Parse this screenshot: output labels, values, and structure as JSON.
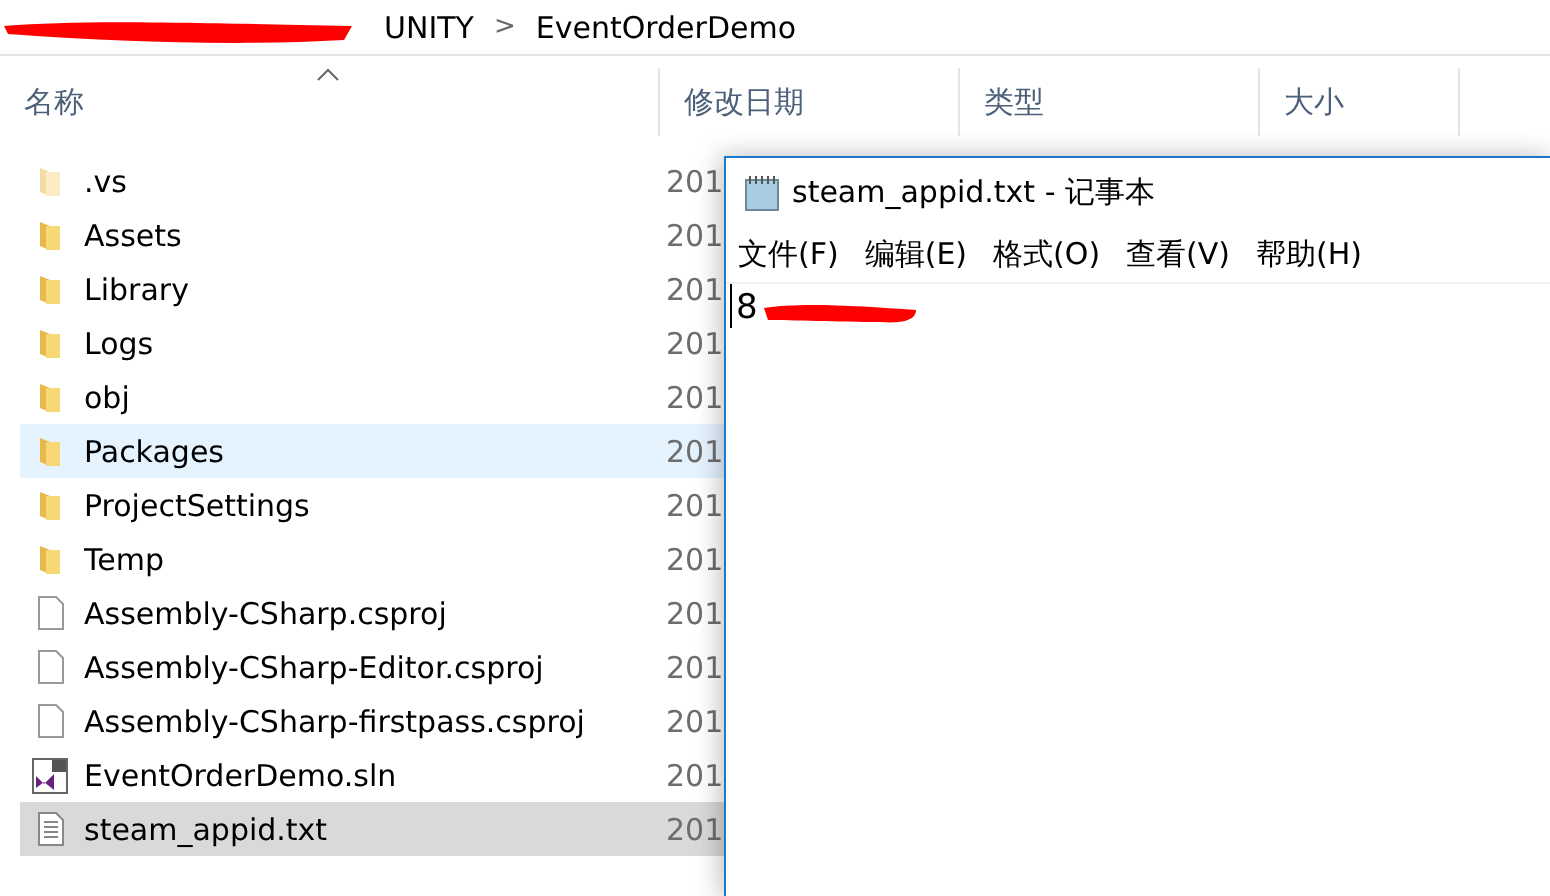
{
  "breadcrumb": {
    "segments": [
      "UNITY",
      "EventOrderDemo"
    ],
    "separator": ">"
  },
  "columns": [
    {
      "label": "名称",
      "sorted": true
    },
    {
      "label": "修改日期",
      "sorted": false
    },
    {
      "label": "类型",
      "sorted": false
    },
    {
      "label": "大小",
      "sorted": false
    }
  ],
  "files": [
    {
      "name": ".vs",
      "kind": "folder",
      "hidden": true,
      "date": "201",
      "hovered": false,
      "selected": false
    },
    {
      "name": "Assets",
      "kind": "folder",
      "hidden": false,
      "date": "201",
      "hovered": false,
      "selected": false
    },
    {
      "name": "Library",
      "kind": "folder",
      "hidden": false,
      "date": "201",
      "hovered": false,
      "selected": false
    },
    {
      "name": "Logs",
      "kind": "folder",
      "hidden": false,
      "date": "201",
      "hovered": false,
      "selected": false
    },
    {
      "name": "obj",
      "kind": "folder",
      "hidden": false,
      "date": "201",
      "hovered": false,
      "selected": false
    },
    {
      "name": "Packages",
      "kind": "folder",
      "hidden": false,
      "date": "201",
      "hovered": true,
      "selected": false
    },
    {
      "name": "ProjectSettings",
      "kind": "folder",
      "hidden": false,
      "date": "201",
      "hovered": false,
      "selected": false
    },
    {
      "name": "Temp",
      "kind": "folder",
      "hidden": false,
      "date": "201",
      "hovered": false,
      "selected": false
    },
    {
      "name": "Assembly-CSharp.csproj",
      "kind": "file",
      "hidden": false,
      "date": "201",
      "hovered": false,
      "selected": false
    },
    {
      "name": "Assembly-CSharp-Editor.csproj",
      "kind": "file",
      "hidden": false,
      "date": "201",
      "hovered": false,
      "selected": false
    },
    {
      "name": "Assembly-CSharp-firstpass.csproj",
      "kind": "file",
      "hidden": false,
      "date": "201",
      "hovered": false,
      "selected": false
    },
    {
      "name": "EventOrderDemo.sln",
      "kind": "solution",
      "hidden": false,
      "date": "201",
      "hovered": false,
      "selected": false
    },
    {
      "name": "steam_appid.txt",
      "kind": "text",
      "hidden": false,
      "date": "201",
      "hovered": false,
      "selected": true
    }
  ],
  "notepad": {
    "title": "steam_appid.txt - 记事本",
    "menu": [
      "文件(F)",
      "编辑(E)",
      "格式(O)",
      "查看(V)",
      "帮助(H)"
    ],
    "content": "8"
  }
}
